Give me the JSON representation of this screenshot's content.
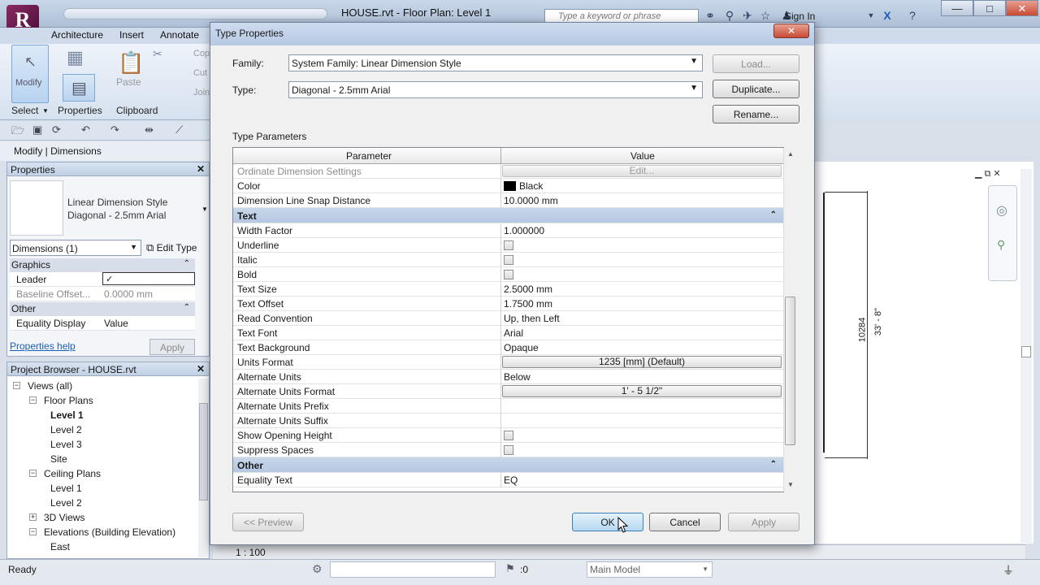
{
  "app": {
    "logo_letter": "R",
    "window_title": "HOUSE.rvt - Floor Plan: Level 1",
    "search_placeholder": "Type a keyword or phrase",
    "signin": "Sign In",
    "win_min": "—",
    "win_max": "□",
    "win_close": "✕"
  },
  "ribbon": {
    "tabs": [
      "Architecture",
      "Insert",
      "Annotate"
    ],
    "modify_label": "Modify",
    "paste_label": "Paste",
    "select_label": "Select",
    "properties_label": "Properties",
    "clipboard_label": "Clipboard",
    "cut_label": "Cut",
    "copy_label": "Cop",
    "join_label": "Join"
  },
  "context_label": "Modify | Dimensions",
  "properties": {
    "title": "Properties",
    "type_family": "Linear Dimension Style",
    "type_name": "Diagonal - 2.5mm Arial",
    "instance_filter": "Dimensions (1)",
    "edit_type": "Edit Type",
    "groups": [
      {
        "name": "Graphics",
        "rows": [
          {
            "name": "Leader",
            "value": "✓"
          },
          {
            "name": "Baseline Offset...",
            "value": "0.0000 mm"
          }
        ]
      },
      {
        "name": "Other",
        "rows": [
          {
            "name": "Equality Display",
            "value": "Value"
          }
        ]
      }
    ],
    "help_link": "Properties help",
    "apply": "Apply"
  },
  "browser": {
    "title": "Project Browser - HOUSE.rvt",
    "items": [
      {
        "label": "Views (all)",
        "level": 0,
        "toggle": "−"
      },
      {
        "label": "Floor Plans",
        "level": 1,
        "toggle": "−"
      },
      {
        "label": "Level 1",
        "level": 2,
        "toggle": "",
        "bold": true
      },
      {
        "label": "Level 2",
        "level": 2,
        "toggle": ""
      },
      {
        "label": "Level 3",
        "level": 2,
        "toggle": ""
      },
      {
        "label": "Site",
        "level": 2,
        "toggle": ""
      },
      {
        "label": "Ceiling Plans",
        "level": 1,
        "toggle": "−"
      },
      {
        "label": "Level 1",
        "level": 2,
        "toggle": ""
      },
      {
        "label": "Level 2",
        "level": 2,
        "toggle": ""
      },
      {
        "label": "3D Views",
        "level": 1,
        "toggle": "+"
      },
      {
        "label": "Elevations (Building Elevation)",
        "level": 1,
        "toggle": "−"
      },
      {
        "label": "East",
        "level": 2,
        "toggle": ""
      }
    ]
  },
  "status": {
    "text": "Ready",
    "scale": "1 : 100",
    "filter_count": ":0",
    "workset": "Main Model"
  },
  "canvas": {
    "dim_value_mm": "10284",
    "dim_value_imperial": "33' - 8\""
  },
  "dialog": {
    "title": "Type Properties",
    "close": "✕",
    "family_label": "Family:",
    "family_value": "System Family: Linear Dimension Style",
    "type_label": "Type:",
    "type_value": "Diagonal - 2.5mm Arial",
    "load_btn": "Load...",
    "duplicate_btn": "Duplicate...",
    "rename_btn": "Rename...",
    "type_params_label": "Type Parameters",
    "col_parameter": "Parameter",
    "col_value": "Value",
    "rows": [
      {
        "kind": "dim",
        "name": "Ordinate Dimension Settings",
        "button": "Edit...",
        "disabled": true
      },
      {
        "kind": "color",
        "name": "Color",
        "value": "Black"
      },
      {
        "kind": "text",
        "name": "Dimension Line Snap Distance",
        "value": "10.0000 mm"
      },
      {
        "kind": "group",
        "name": "Text"
      },
      {
        "kind": "text",
        "name": "Width Factor",
        "value": "1.000000"
      },
      {
        "kind": "check",
        "name": "Underline"
      },
      {
        "kind": "check",
        "name": "Italic"
      },
      {
        "kind": "check",
        "name": "Bold"
      },
      {
        "kind": "text",
        "name": "Text Size",
        "value": "2.5000 mm"
      },
      {
        "kind": "text",
        "name": "Text Offset",
        "value": "1.7500 mm"
      },
      {
        "kind": "text",
        "name": "Read Convention",
        "value": "Up, then Left"
      },
      {
        "kind": "text",
        "name": "Text Font",
        "value": "Arial"
      },
      {
        "kind": "text",
        "name": "Text Background",
        "value": "Opaque"
      },
      {
        "kind": "button",
        "name": "Units Format",
        "button": "1235 [mm] (Default)"
      },
      {
        "kind": "text",
        "name": "Alternate Units",
        "value": "Below"
      },
      {
        "kind": "button",
        "name": "Alternate Units Format",
        "button": "1' - 5 1/2\""
      },
      {
        "kind": "text",
        "name": "Alternate Units Prefix",
        "value": ""
      },
      {
        "kind": "text",
        "name": "Alternate Units Suffix",
        "value": ""
      },
      {
        "kind": "check",
        "name": "Show Opening Height"
      },
      {
        "kind": "check",
        "name": "Suppress Spaces"
      },
      {
        "kind": "group",
        "name": "Other"
      },
      {
        "kind": "text",
        "name": "Equality Text",
        "value": "EQ"
      }
    ],
    "preview_btn": "<< Preview",
    "ok_btn": "OK",
    "cancel_btn": "Cancel",
    "apply_btn": "Apply"
  }
}
